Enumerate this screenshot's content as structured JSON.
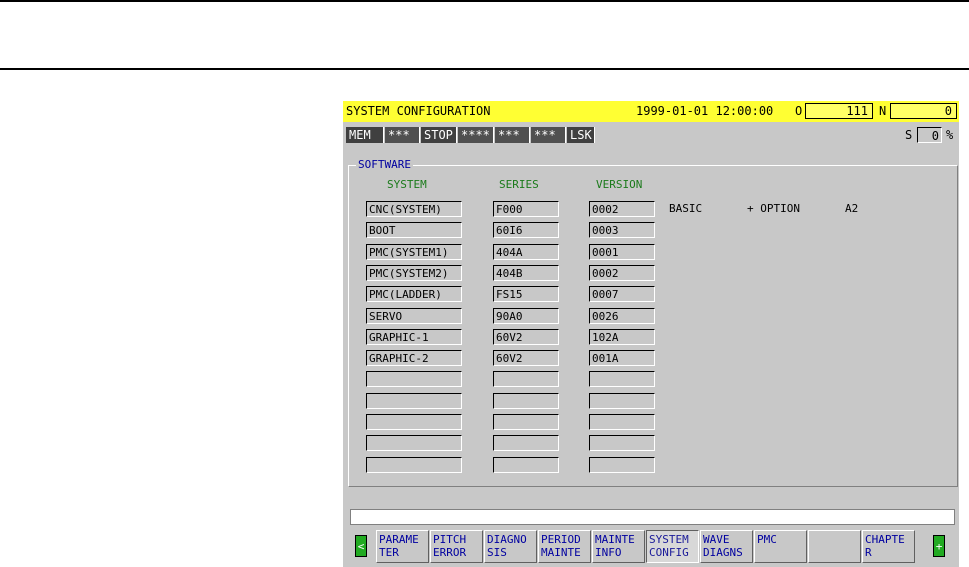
{
  "title": "SYSTEM CONFIGURATION",
  "datetime": "1999-01-01 12:00:00",
  "o_label": "O",
  "o_value": "111",
  "n_label": "N",
  "n_value": "0",
  "status": {
    "segments": [
      "MEM",
      "***",
      "STOP",
      "****",
      "***",
      "***",
      "LSK"
    ],
    "s_label": "S",
    "s_value": "0",
    "s_unit": "%"
  },
  "panel": {
    "label": "SOFTWARE",
    "headers": {
      "system": "SYSTEM",
      "series": "SERIES",
      "version": "VERSION"
    },
    "rows": [
      {
        "system": "CNC(SYSTEM)",
        "series": "F000",
        "version": "0002"
      },
      {
        "system": "BOOT",
        "series": "60I6",
        "version": "0003"
      },
      {
        "system": "PMC(SYSTEM1)",
        "series": "404A",
        "version": "0001"
      },
      {
        "system": "PMC(SYSTEM2)",
        "series": "404B",
        "version": "0002"
      },
      {
        "system": "PMC(LADDER)",
        "series": "FS15",
        "version": "0007"
      },
      {
        "system": "SERVO",
        "series": "90A0",
        "version": "0026"
      },
      {
        "system": "GRAPHIC-1",
        "series": "60V2",
        "version": "102A"
      },
      {
        "system": "GRAPHIC-2",
        "series": "60V2",
        "version": "001A"
      },
      {
        "system": "",
        "series": "",
        "version": ""
      },
      {
        "system": "",
        "series": "",
        "version": ""
      },
      {
        "system": "",
        "series": "",
        "version": ""
      },
      {
        "system": "",
        "series": "",
        "version": ""
      },
      {
        "system": "",
        "series": "",
        "version": ""
      }
    ],
    "info": {
      "basic": "BASIC",
      "plus_option": "+ OPTION",
      "code": "A2"
    }
  },
  "softkeys": {
    "left_arrow": "<",
    "right_arrow": "+",
    "keys": [
      {
        "label": "PARAME\nTER",
        "active": false
      },
      {
        "label": "PITCH\nERROR",
        "active": false
      },
      {
        "label": "DIAGNO\nSIS",
        "active": false
      },
      {
        "label": "PERIOD\nMAINTE",
        "active": false
      },
      {
        "label": "MAINTE\nINFO",
        "active": false
      },
      {
        "label": "SYSTEM\nCONFIG",
        "active": true
      },
      {
        "label": "WAVE\nDIAGNS",
        "active": false
      },
      {
        "label": "PMC",
        "active": false
      },
      {
        "label": "",
        "active": false
      },
      {
        "label": "CHAPTE\nR",
        "active": false
      }
    ]
  },
  "colors": {
    "title_bg": "#ffff33",
    "header_text": "#1a7a1a",
    "softkey_text": "#0000a0",
    "arrow_bg": "#22aa22"
  }
}
